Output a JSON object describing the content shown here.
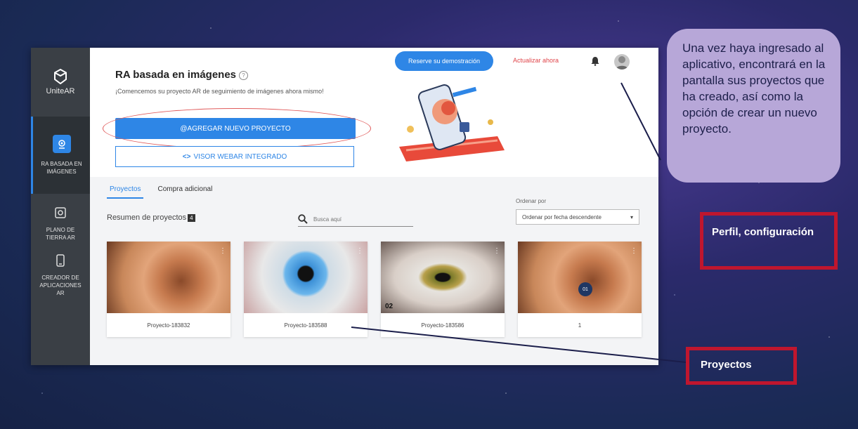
{
  "sidebar": {
    "brand": "UniteAR",
    "items": [
      {
        "label": "RA BASADA EN IMÁGENES",
        "icon": "image-target-icon",
        "active": true
      },
      {
        "label": "PLANO DE TIERRA AR",
        "icon": "ground-plane-icon",
        "active": false
      },
      {
        "label": "CREADOR DE APLICACIONES AR",
        "icon": "phone-app-icon",
        "active": false
      }
    ]
  },
  "header": {
    "title": "RA basada en imágenes",
    "subtitle": "¡Comencemos su proyecto AR de seguimiento de imágenes ahora mismo!",
    "demo_label": "Reserve su demostración",
    "update_label": "Actualizar ahora"
  },
  "actions": {
    "new_project": "AGREGAR NUEVO PROYECTO",
    "viewer": "VISOR WEBAR INTEGRADO"
  },
  "tabs": [
    {
      "label": "Proyectos",
      "active": true
    },
    {
      "label": "Compra adicional",
      "active": false
    }
  ],
  "projects_summary": {
    "label": "Resumen de proyectos",
    "count": "4"
  },
  "search": {
    "placeholder": "Busca aquí"
  },
  "sort": {
    "label": "Ordenar por",
    "selected": "Ordenar por fecha descendente"
  },
  "cards": [
    {
      "name": "Proyecto-183832",
      "image": "ear"
    },
    {
      "name": "Proyecto-183588",
      "image": "blue-eye"
    },
    {
      "name": "Proyecto-183586",
      "image": "green-eye",
      "overlay": "02"
    },
    {
      "name": "1",
      "image": "ear",
      "badge": "01"
    }
  ],
  "annotations": {
    "bubble": "Una vez haya ingresado al aplicativo, encontrará en la pantalla sus proyectos que ha creado, así como la opción de crear un nuevo proyecto.",
    "profile_box": "Perfil, configuración",
    "projects_box": "Proyectos"
  },
  "colors": {
    "accent": "#2e86e6",
    "sidebar": "#3a3f45",
    "annotation_red": "#c0162e",
    "bubble": "#b7a7d8"
  }
}
